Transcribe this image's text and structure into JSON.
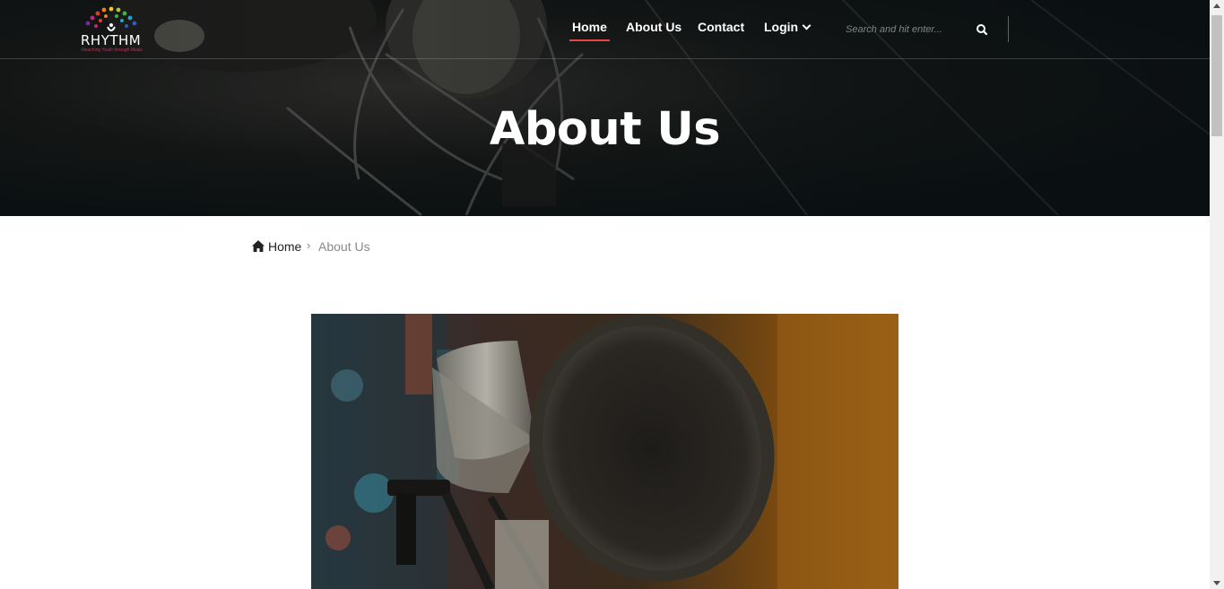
{
  "header": {
    "logo_text": "RHYTHM",
    "logo_tagline": "Reaching Youth through Music",
    "nav": [
      {
        "label": "Home",
        "active": true
      },
      {
        "label": "About Us",
        "active": false
      },
      {
        "label": "Contact",
        "active": false
      },
      {
        "label": "Login",
        "active": false,
        "has_dropdown": true
      }
    ],
    "search": {
      "placeholder": "Search and hit enter...",
      "icon": "search-icon"
    }
  },
  "hero": {
    "title": "About Us"
  },
  "breadcrumb": {
    "home_icon": "home-icon",
    "home_label": "Home",
    "separator": "›",
    "current_label": "About Us"
  },
  "colors": {
    "hero_bg": "#0a0f11",
    "nav_active_underline": "#e84545",
    "breadcrumb_current": "#8a8a8a"
  }
}
